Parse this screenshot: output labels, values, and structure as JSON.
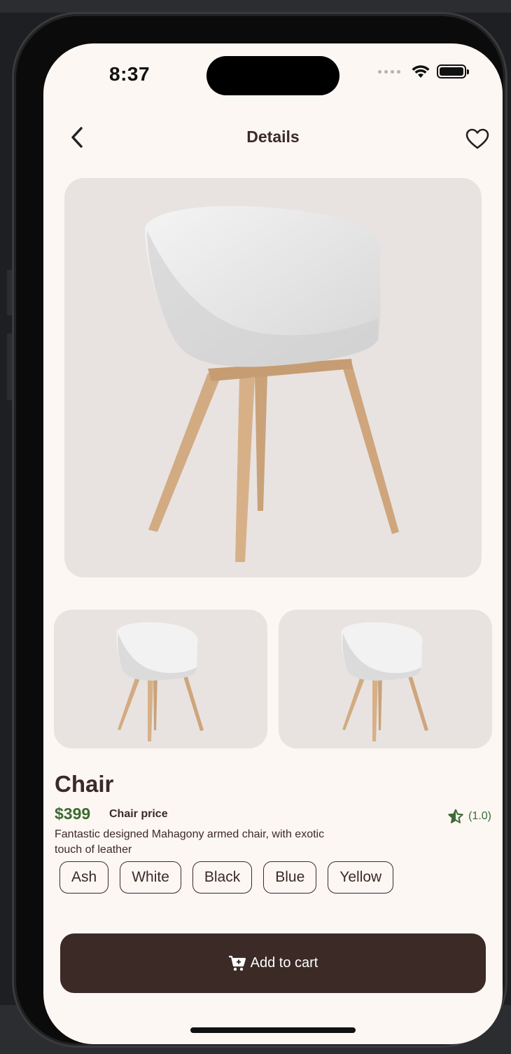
{
  "status_bar": {
    "time": "8:37"
  },
  "appbar": {
    "title": "Details",
    "back_icon": "chevron-left-icon",
    "favorite_icon": "heart-outline-icon"
  },
  "product": {
    "name": "Chair",
    "price": "$399",
    "price_label": "Chair price",
    "rating": "(1.0)",
    "description": "Fantastic designed Mahagony armed chair, with exotic touch of leather",
    "colors": [
      "Ash",
      "White",
      "Black",
      "Blue",
      "Yellow"
    ]
  },
  "actions": {
    "add_to_cart_label": "Add to cart",
    "cart_icon": "cart-plus-icon"
  },
  "theme": {
    "background": "#fdf7f4",
    "primary": "#3b2a26",
    "accent_green": "#3d6b30",
    "image_bg": "#e8e3e0"
  }
}
